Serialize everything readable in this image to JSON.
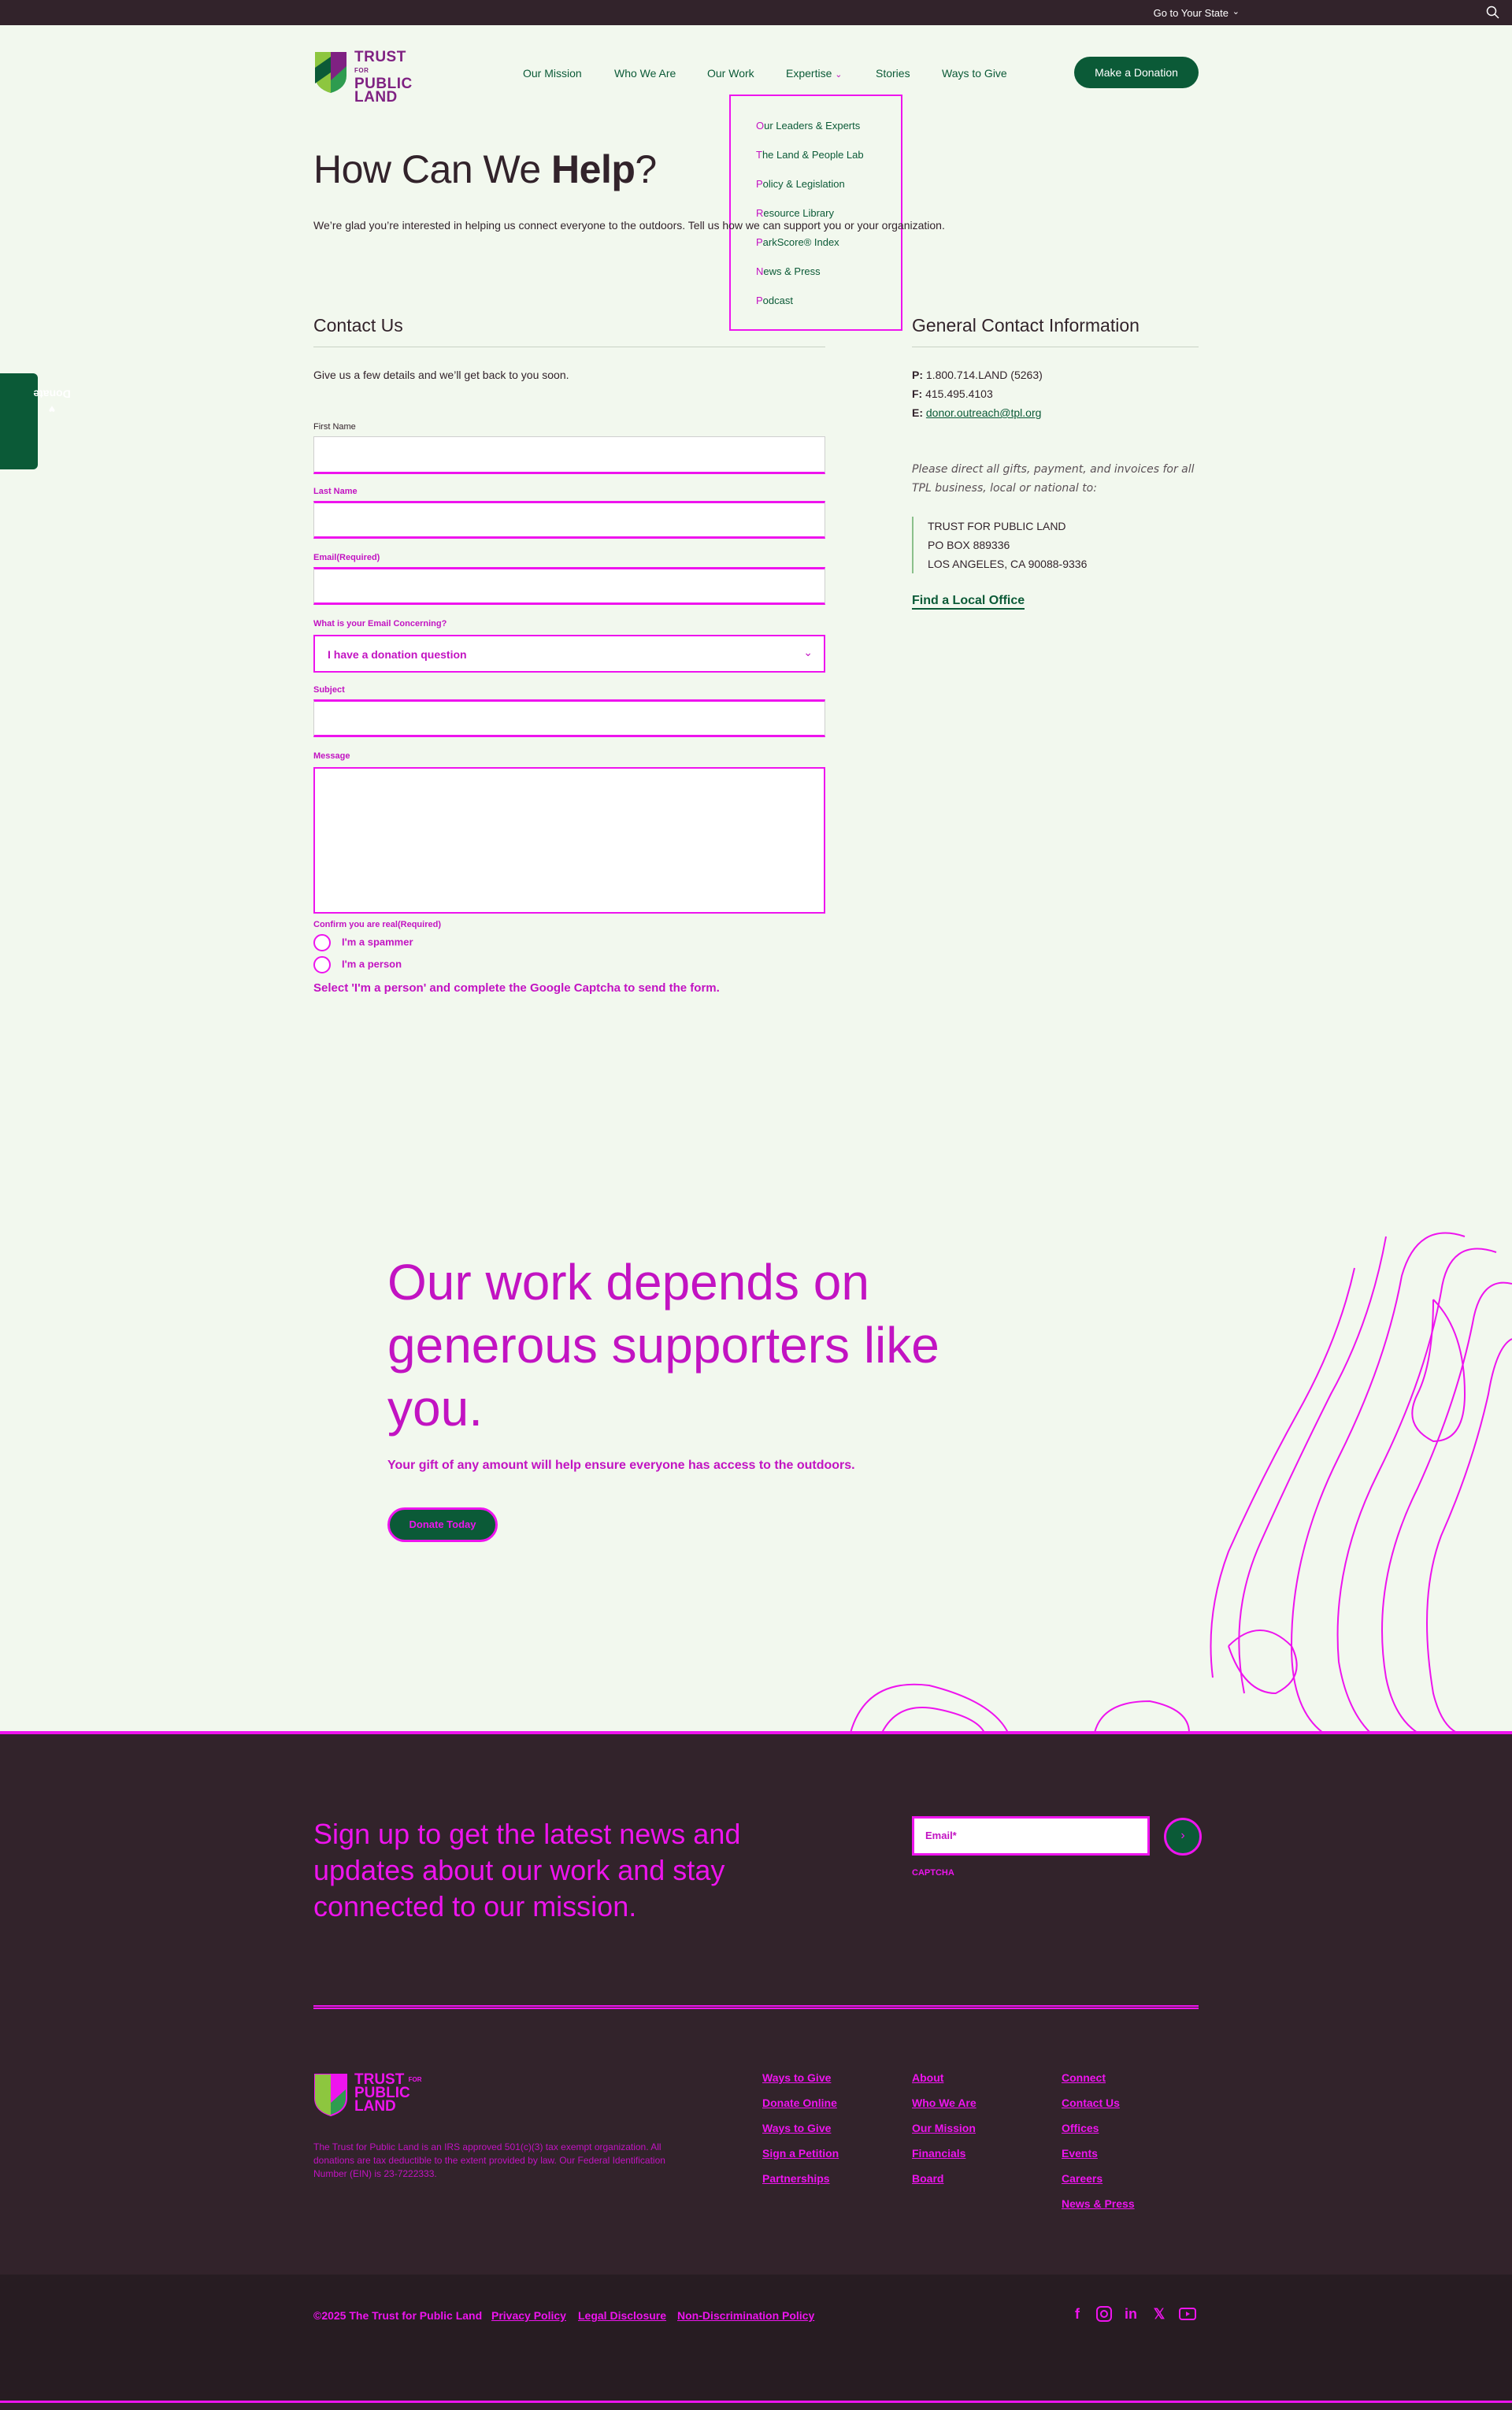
{
  "topbar": {
    "state_label": "Go to Your State"
  },
  "logo": {
    "line1": "TRUST",
    "line1_small": "FOR",
    "line2": "PUBLIC",
    "line3": "LAND"
  },
  "nav": {
    "items": [
      "Our Mission",
      "Who We Are",
      "Our Work",
      "Expertise",
      "Stories",
      "Ways to Give"
    ],
    "donate_label": "Make a Donation"
  },
  "dropdown": {
    "items": [
      "Our Leaders & Experts",
      "The Land & People Lab",
      "Policy & Legislation",
      "Resource Library",
      "ParkScore® Index",
      "News & Press",
      "Podcast"
    ]
  },
  "page": {
    "title_light": "How Can We ",
    "title_bold": "Help",
    "title_end": "?",
    "intro": "We’re glad you’re interested in helping us connect everyone to the outdoors. Tell us how we can support you or your organization."
  },
  "contact_form": {
    "title": "Contact Us",
    "subtext": "Give us a few details and we’ll get back to you soon.",
    "first_name_label": "First Name",
    "last_name_label": "Last Name",
    "email_label": "Email(Required)",
    "concern_label": "What is your Email Concerning?",
    "concern_value": "I have a donation question",
    "subject_label": "Subject",
    "message_label": "Message",
    "confirm_label": "Confirm you are real(Required)",
    "radio_spammer": "I'm a spammer",
    "radio_person": "I'm a person",
    "warning": "Select 'I'm a person' and complete the Google Captcha to send the form."
  },
  "general_contact": {
    "title": "General Contact Information",
    "phone_label": "P:",
    "phone": "1.800.714.LAND (5263)",
    "fax_label": "F:",
    "fax": "415.495.4103",
    "email_label": "E:",
    "email": "donor.outreach@tpl.org",
    "note": "Please direct all gifts, payment, and invoices for all TPL business, local or national to:",
    "address": [
      "TRUST FOR PUBLIC LAND",
      "PO BOX 889336",
      "LOS ANGELES, CA 90088-9336"
    ],
    "find_office": "Find a Local Office"
  },
  "side_donate": {
    "label": "Donate"
  },
  "support": {
    "title": "Our work depends on generous supporters like you.",
    "subtitle": "Your gift of any amount will help ensure everyone has access to the outdoors.",
    "button": "Donate Today"
  },
  "footer": {
    "signup_title": "Sign up to get the latest news and updates about our work and stay connected to our mission.",
    "email_placeholder": "Email*",
    "captcha": "CAPTCHA",
    "legal": "The Trust for Public Land is an IRS approved 501(c)(3) tax exempt organization. All donations are tax deductible to the extent provided by law. Our Federal Identification Number (EIN) is 23-7222333.",
    "col1": {
      "head": "Ways to Give",
      "links": [
        "Donate Online",
        "Ways to Give",
        "Sign a Petition",
        "Partnerships"
      ]
    },
    "col2": {
      "head": "About",
      "links": [
        "Who We Are",
        "Our Mission",
        "Financials",
        "Board"
      ]
    },
    "col3": {
      "head": "Connect",
      "links": [
        "Contact Us",
        "Offices",
        "Events",
        "Careers",
        "News & Press"
      ]
    }
  },
  "bottom": {
    "copyright": "©2025 The Trust for Public Land",
    "links": [
      "Privacy Policy",
      "Legal Disclosure",
      "Non-Discrimination Policy"
    ],
    "social_icons": [
      "facebook-icon",
      "instagram-icon",
      "linkedin-icon",
      "x-icon",
      "youtube-icon"
    ]
  },
  "colors": {
    "brand_green": "#0b5a37",
    "brand_purple": "#32232b",
    "accent_magenta": "#ee14ee",
    "page_bg": "#f2f8ee"
  }
}
